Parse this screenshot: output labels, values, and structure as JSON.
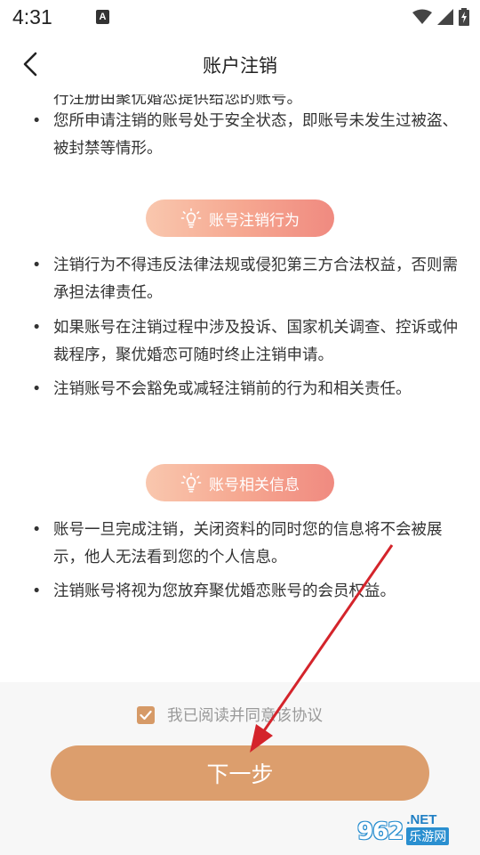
{
  "status_bar": {
    "time": "4:31",
    "notification_icon": "A",
    "icons": [
      "wifi-icon",
      "signal-icon",
      "battery-charging-icon"
    ]
  },
  "header": {
    "back_icon": "chevron-left-icon",
    "title": "账户注销"
  },
  "content": {
    "cut_line": "行注册由聚优婚恋提供给您的账号。",
    "section1_items": [
      "您所申请注销的账号处于安全状态，即账号未发生过被盗、被封禁等情形。"
    ],
    "section2": {
      "title": "账号注销行为",
      "icon": "lightbulb-icon",
      "items": [
        "注销行为不得违反法律法规或侵犯第三方合法权益，否则需承担法律责任。",
        "如果账号在注销过程中涉及投诉、国家机关调查、控诉或仲裁程序，聚优婚恋可随时终止注销申请。",
        "注销账号不会豁免或减轻注销前的行为和相关责任。"
      ]
    },
    "section3": {
      "title": "账号相关信息",
      "icon": "lightbulb-icon",
      "items": [
        "账号一旦完成注销，关闭资料的同时您的信息将不会被展示，他人无法看到您的个人信息。",
        "注销账号将视为您放弃聚优婚恋账号的会员权益。"
      ]
    },
    "bullet": "•"
  },
  "footer": {
    "agree_checked": true,
    "agree_text": "我已阅读并同意该协议",
    "next_label": "下一步"
  },
  "watermark": {
    "logo": "962",
    "net": ".NET",
    "site": "乐游网"
  },
  "colors": {
    "accent": "#dc9e6d",
    "checkbox": "#d69a67",
    "pill_start": "#f9c7ae",
    "pill_end": "#f08a80",
    "arrow": "#d4242b"
  }
}
